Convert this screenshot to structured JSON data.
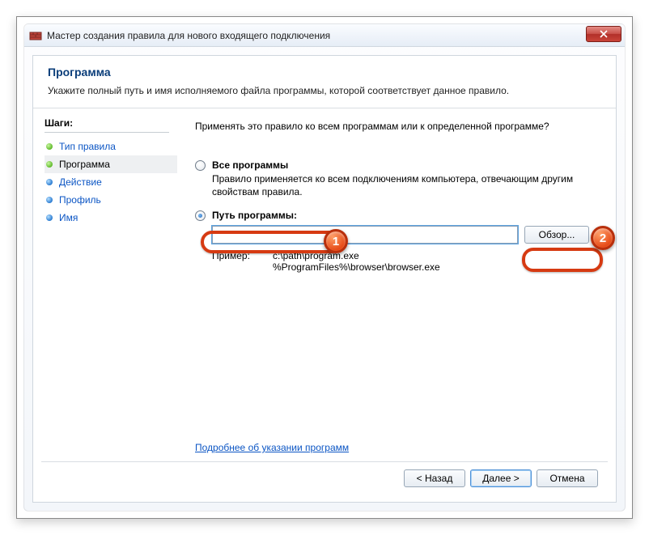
{
  "window": {
    "title": "Мастер создания правила для нового входящего подключения"
  },
  "header": {
    "title": "Программа",
    "subtitle": "Укажите полный путь и имя исполняемого файла программы, которой соответствует данное правило."
  },
  "sidebar": {
    "title": "Шаги:",
    "items": [
      {
        "label": "Тип правила"
      },
      {
        "label": "Программа"
      },
      {
        "label": "Действие"
      },
      {
        "label": "Профиль"
      },
      {
        "label": "Имя"
      }
    ]
  },
  "main": {
    "prompt": "Применять это правило ко всем программам или к определенной программе?",
    "option_all": {
      "label": "Все программы",
      "desc": "Правило применяется ко всем подключениям компьютера, отвечающим другим свойствам правила."
    },
    "option_path": {
      "label": "Путь программы:",
      "value": "",
      "browse": "Обзор...",
      "example_label": "Пример:",
      "example_lines": "c:\\path\\program.exe\n%ProgramFiles%\\browser\\browser.exe"
    },
    "more_link": "Подробнее об указании программ"
  },
  "footer": {
    "back": "< Назад",
    "next": "Далее >",
    "cancel": "Отмена"
  },
  "callouts": {
    "one": "1",
    "two": "2"
  }
}
